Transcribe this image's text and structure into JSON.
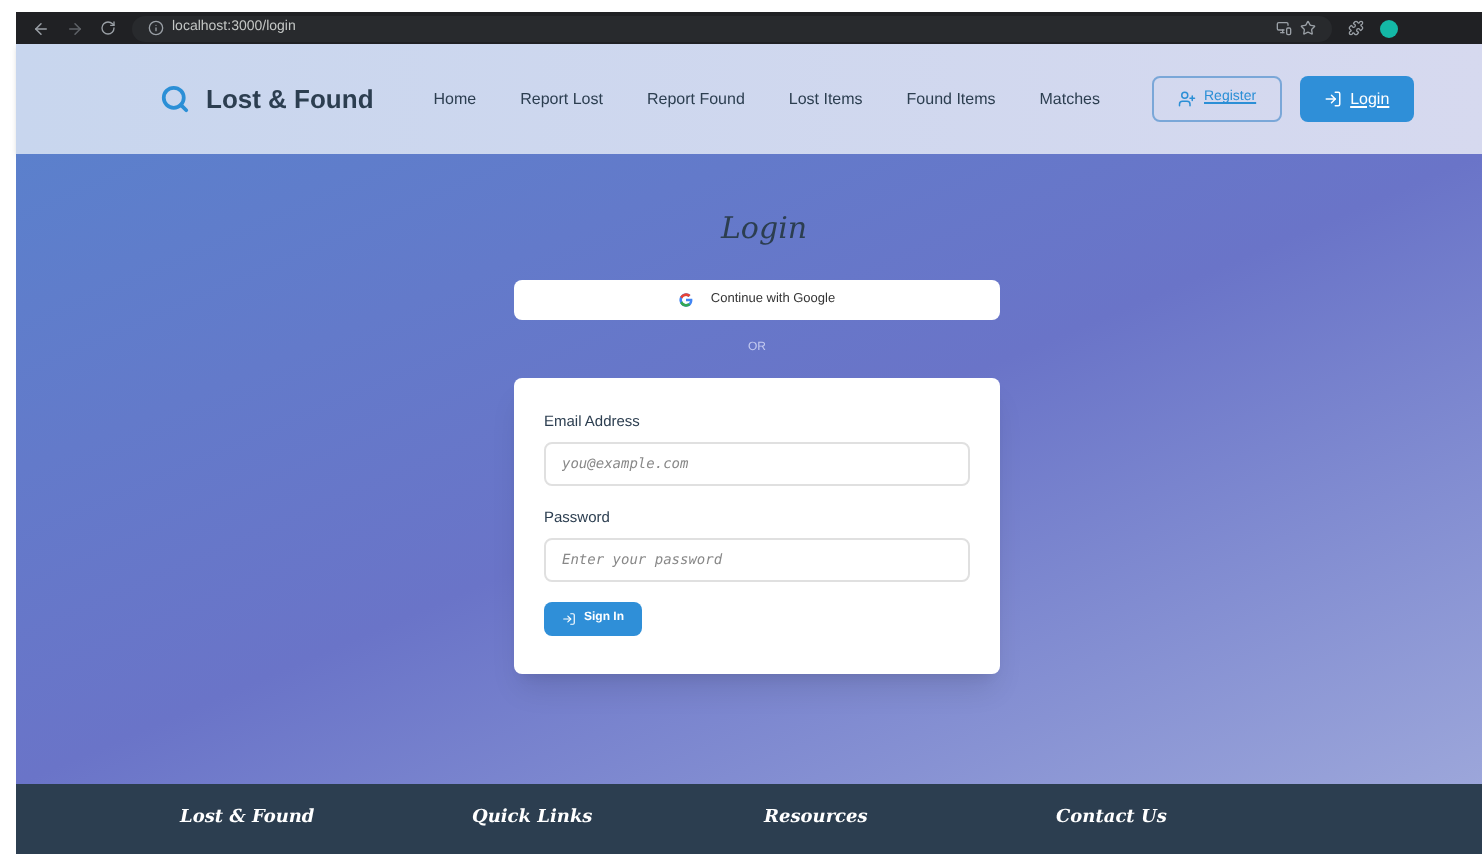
{
  "browser": {
    "url": "localhost:3000/login"
  },
  "nav": {
    "brand": "Lost & Found",
    "links": [
      {
        "label": "Home",
        "selected": false
      },
      {
        "label": "Report Lost",
        "selected": false
      },
      {
        "label": "Report Found",
        "selected": false
      },
      {
        "label": "Lost Items",
        "selected": false
      },
      {
        "label": "Found Items",
        "selected": false
      },
      {
        "label": "Matches",
        "selected": false
      }
    ],
    "register": "Register",
    "login": "Login"
  },
  "title": "Login",
  "google_button": "Continue with Google",
  "divider": "OR",
  "form": {
    "email_label": "Email Address",
    "email_placeholder": "you@example.com",
    "password_label": "Password",
    "password_placeholder": "Enter your password",
    "submit": "Sign In"
  },
  "footer": {
    "headings": [
      "Lost & Found",
      "Quick Links",
      "Resources",
      "Contact Us"
    ]
  }
}
